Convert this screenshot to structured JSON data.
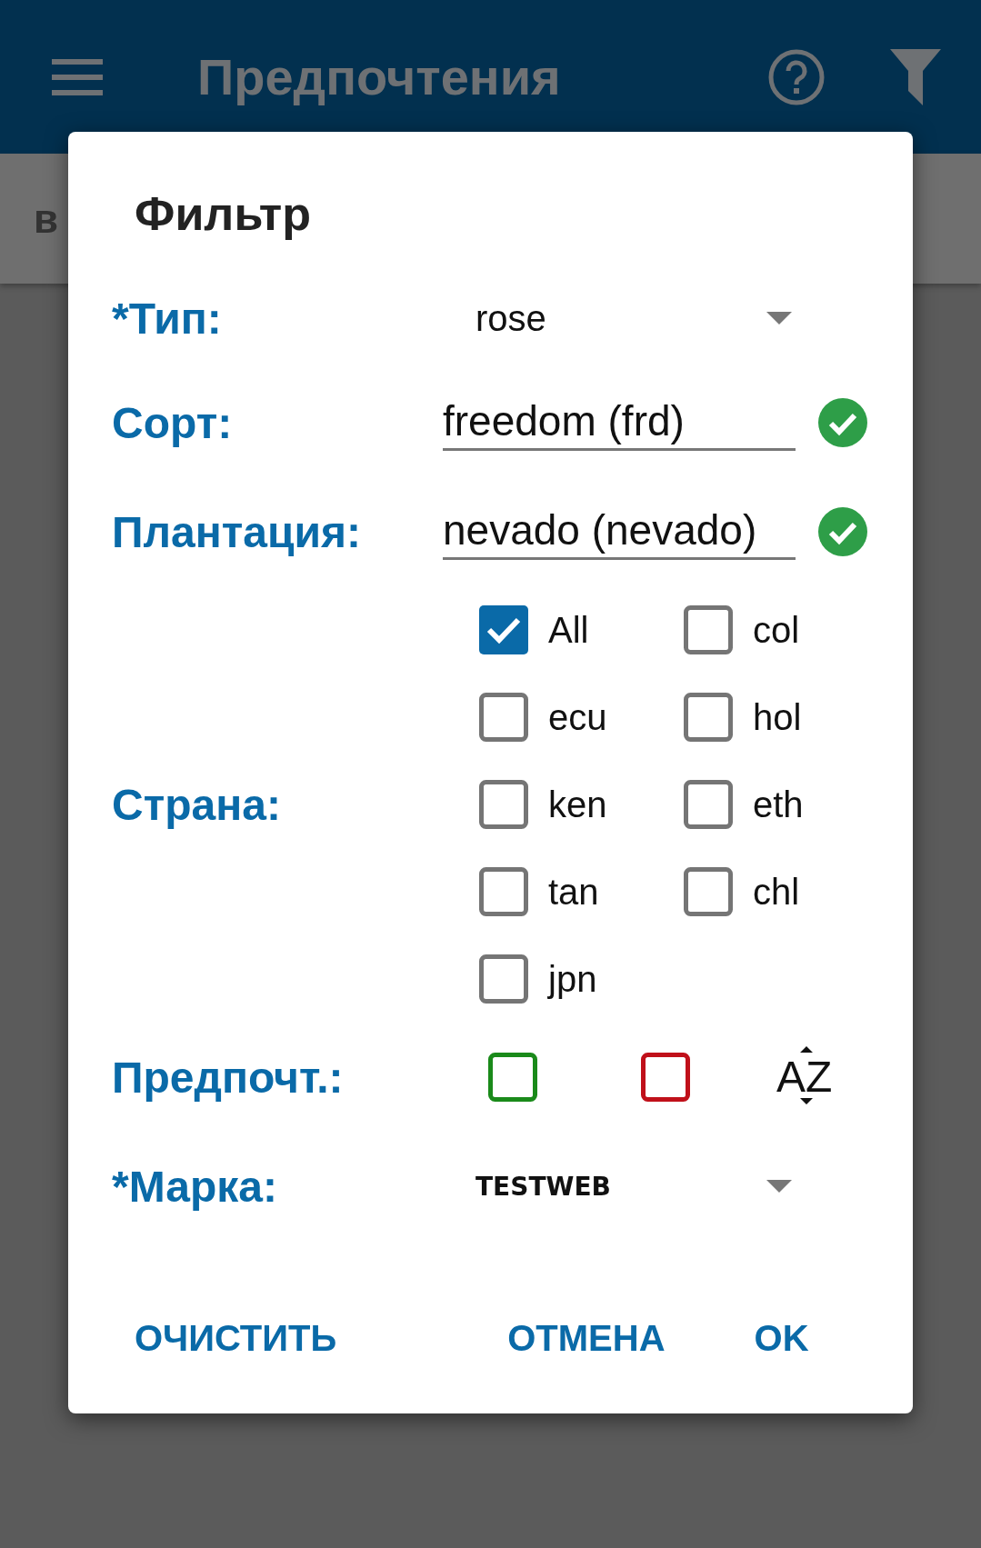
{
  "app_bar": {
    "title": "Предпочтения"
  },
  "background_text": "в",
  "dialog": {
    "title": "Фильтр",
    "type": {
      "label": "*Тип:",
      "value": "rose"
    },
    "variety": {
      "label": "Сорт:",
      "value": "freedom (frd)",
      "valid": true
    },
    "plantation": {
      "label": "Плантация:",
      "value": "nevado (nevado)",
      "valid": true
    },
    "country": {
      "label": "Страна:",
      "options": [
        {
          "label": "All",
          "checked": true
        },
        {
          "label": "col",
          "checked": false
        },
        {
          "label": "ecu",
          "checked": false
        },
        {
          "label": "hol",
          "checked": false
        },
        {
          "label": "ken",
          "checked": false
        },
        {
          "label": "eth",
          "checked": false
        },
        {
          "label": "tan",
          "checked": false
        },
        {
          "label": "chl",
          "checked": false
        },
        {
          "label": "jpn",
          "checked": false
        }
      ]
    },
    "preference": {
      "label": "Предпочт.:",
      "options": [
        {
          "color": "#1a8a1a",
          "checked": false
        },
        {
          "color": "#c0101a",
          "checked": false
        }
      ],
      "sort_label": "AZ"
    },
    "brand": {
      "label": "*Марка:",
      "value": "TESTWEB"
    },
    "buttons": [
      "ОЧИСТИТЬ",
      "ОТМЕНА",
      "OK"
    ]
  }
}
